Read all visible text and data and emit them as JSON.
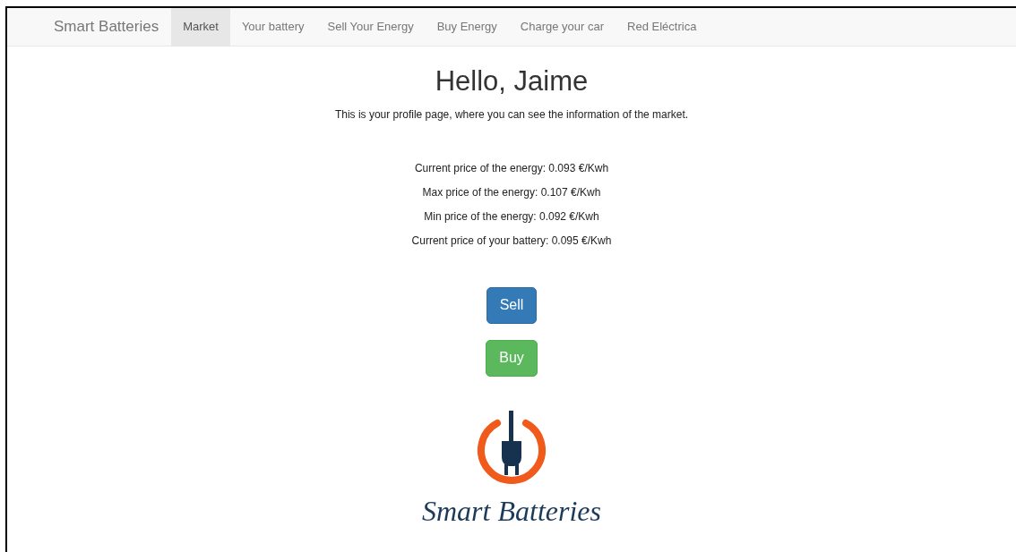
{
  "navbar": {
    "brand": "Smart Batteries",
    "items": [
      {
        "label": "Market",
        "selected": true
      },
      {
        "label": "Your battery",
        "selected": false
      },
      {
        "label": "Sell Your Energy",
        "selected": false
      },
      {
        "label": "Buy Energy",
        "selected": false
      },
      {
        "label": "Charge your car",
        "selected": false
      },
      {
        "label": "Red Eléctrica",
        "selected": false
      }
    ]
  },
  "heading": "Hello, Jaime",
  "subtitle": "This is your profile page, where you can see the information of the market.",
  "prices": [
    "Current price of the energy: 0.093 €/Kwh",
    "Max price of the energy: 0.107 €/Kwh",
    "Min price of the energy: 0.092 €/Kwh",
    "Current price of your battery: 0.095 €/Kwh"
  ],
  "buttons": [
    {
      "label": "Sell",
      "kind": "primary"
    },
    {
      "label": "Buy",
      "kind": "success"
    }
  ],
  "logo": {
    "text": "Smart Batteries"
  }
}
